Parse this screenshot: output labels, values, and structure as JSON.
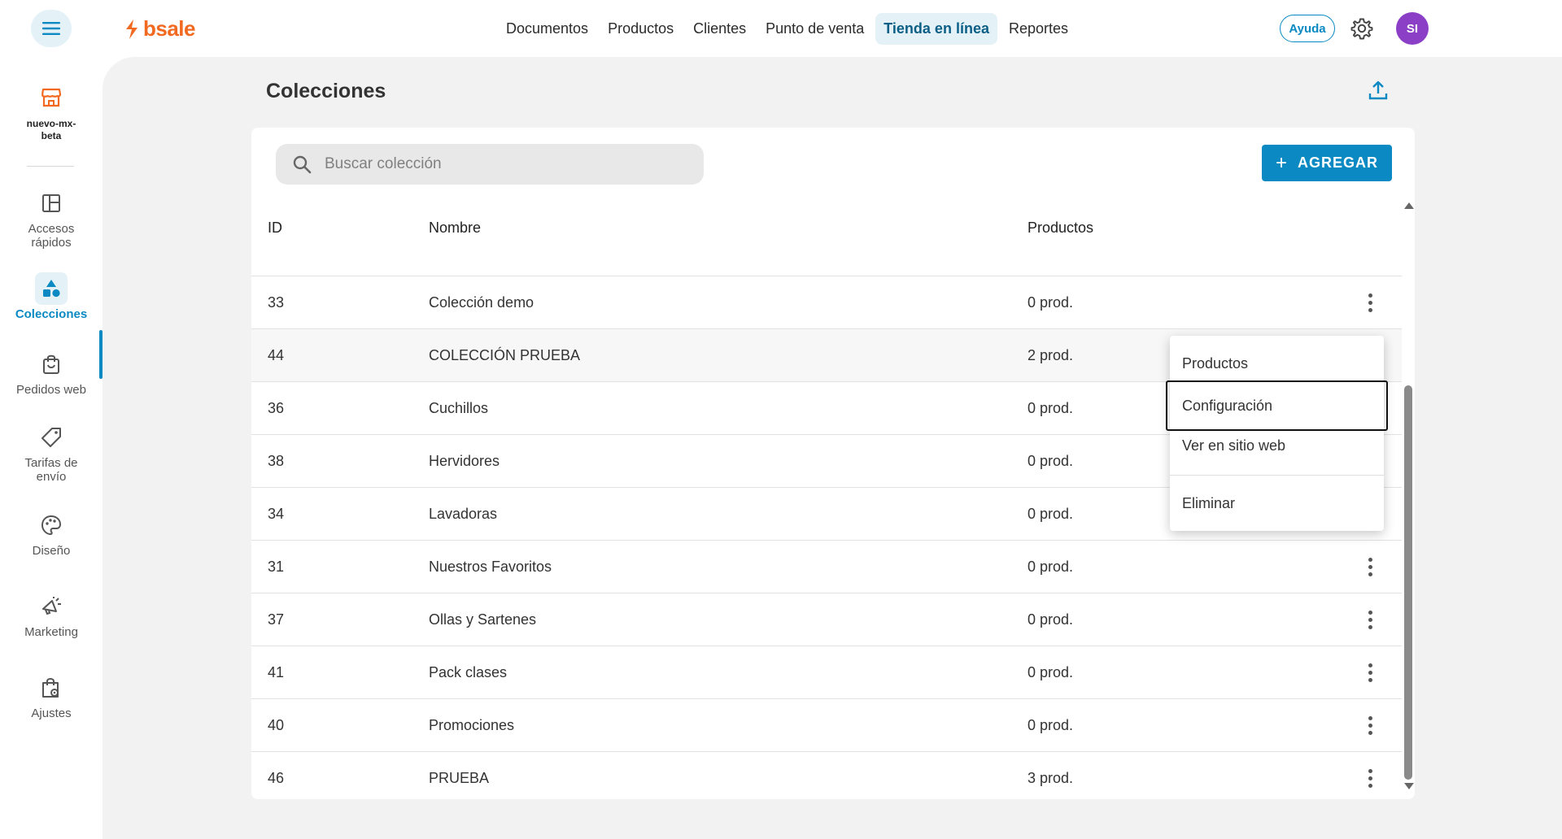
{
  "header": {
    "brand": "bsale",
    "nav": [
      "Documentos",
      "Productos",
      "Clientes",
      "Punto de venta",
      "Tienda en línea",
      "Reportes"
    ],
    "active_nav": "Tienda en línea",
    "help_label": "Ayuda",
    "avatar_initials": "SI"
  },
  "sidebar": {
    "store_name_line1": "nuevo-mx-",
    "store_name_line2": "beta",
    "items": [
      {
        "label": "Accesos rápidos",
        "line1": "Accesos",
        "line2": "rápidos"
      },
      {
        "label": "Colecciones",
        "line1": "Colecciones",
        "line2": ""
      },
      {
        "label": "Pedidos web",
        "line1": "Pedidos web",
        "line2": ""
      },
      {
        "label": "Tarifas de envío",
        "line1": "Tarifas de",
        "line2": "envío"
      },
      {
        "label": "Diseño",
        "line1": "Diseño",
        "line2": ""
      },
      {
        "label": "Marketing",
        "line1": "Marketing",
        "line2": ""
      },
      {
        "label": "Ajustes",
        "line1": "Ajustes",
        "line2": ""
      }
    ]
  },
  "page": {
    "title": "Colecciones",
    "search_placeholder": "Buscar colección",
    "add_label": "AGREGAR"
  },
  "table": {
    "columns": [
      "ID",
      "Nombre",
      "Productos"
    ],
    "rows": [
      {
        "id": "33",
        "name": "Colección demo",
        "products": "0 prod."
      },
      {
        "id": "44",
        "name": "COLECCIÓN PRUEBA",
        "products": "2 prod."
      },
      {
        "id": "36",
        "name": "Cuchillos",
        "products": "0 prod."
      },
      {
        "id": "38",
        "name": "Hervidores",
        "products": "0 prod."
      },
      {
        "id": "34",
        "name": "Lavadoras",
        "products": "0 prod."
      },
      {
        "id": "31",
        "name": "Nuestros Favoritos",
        "products": "0 prod."
      },
      {
        "id": "37",
        "name": "Ollas y Sartenes",
        "products": "0 prod."
      },
      {
        "id": "41",
        "name": "Pack clases",
        "products": "0 prod."
      },
      {
        "id": "40",
        "name": "Promociones",
        "products": "0 prod."
      },
      {
        "id": "46",
        "name": "PRUEBA",
        "products": "3 prod."
      }
    ]
  },
  "context_menu": {
    "items": [
      "Productos",
      "Configuración",
      "Ver en sitio web",
      "Eliminar"
    ],
    "focused": "Configuración"
  },
  "colors": {
    "accent": "#0a89c2",
    "brand": "#f26a21",
    "avatar": "#8b3fc6"
  }
}
